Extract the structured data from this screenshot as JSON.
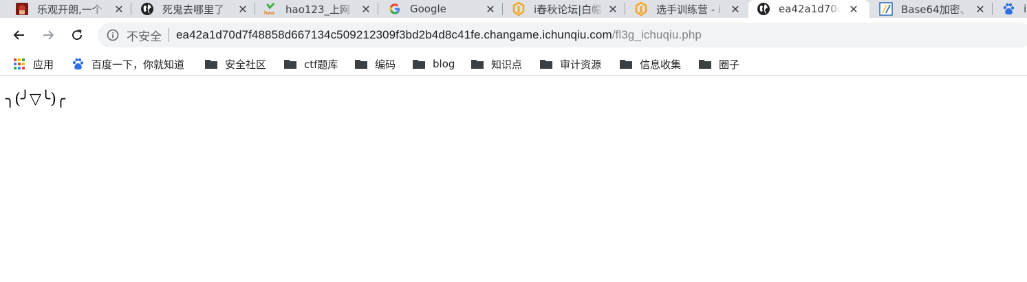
{
  "tabs": [
    {
      "title": "乐观开朗,一个",
      "favicon": "red-image-favicon-icon"
    },
    {
      "title": "死鬼去哪里了",
      "favicon": "globe-icon"
    },
    {
      "title": "hao123_上网",
      "favicon": "hao123-favicon-icon"
    },
    {
      "title": "Google",
      "favicon": "google-g-icon"
    },
    {
      "title": "i春秋论坛|白帽",
      "favicon": "ichunqiu-favicon-icon"
    },
    {
      "title": "选手训练营 - i",
      "favicon": "ichunqiu-favicon-icon"
    },
    {
      "title": "ea42a1d70d7",
      "favicon": "globe-icon",
      "active": true
    },
    {
      "title": "Base64加密、",
      "favicon": "base64-favicon-icon"
    },
    {
      "title": "i",
      "favicon": "baidu-paw-icon"
    }
  ],
  "toolbar": {
    "insecure_label": "不安全",
    "url_host": "ea42a1d70d7f48858d667134c509212309f3bd2b4d8c41fe.changame.ichunqiu.com",
    "url_path": "/fl3g_ichuqiu.php"
  },
  "bookmarks": [
    {
      "label": "应用",
      "icon": "apps-grid-icon"
    },
    {
      "label": "百度一下，你就知道",
      "icon": "baidu-paw-icon"
    },
    {
      "label": "安全社区",
      "icon": "folder-icon"
    },
    {
      "label": "ctf题库",
      "icon": "folder-icon"
    },
    {
      "label": "编码",
      "icon": "folder-icon"
    },
    {
      "label": "blog",
      "icon": "folder-icon"
    },
    {
      "label": "知识点",
      "icon": "folder-icon"
    },
    {
      "label": "审计资源",
      "icon": "folder-icon"
    },
    {
      "label": "信息收集",
      "icon": "folder-icon"
    },
    {
      "label": "圈子",
      "icon": "folder-icon"
    }
  ],
  "page": {
    "body_text": "╮(╯▽╰)╭"
  },
  "colors": {
    "tabstrip_bg": "#dee1e6",
    "omnibox_bg": "#f1f3f4",
    "ichunqiu_orange": "#f5a623",
    "folder_gray": "#3c4043"
  }
}
